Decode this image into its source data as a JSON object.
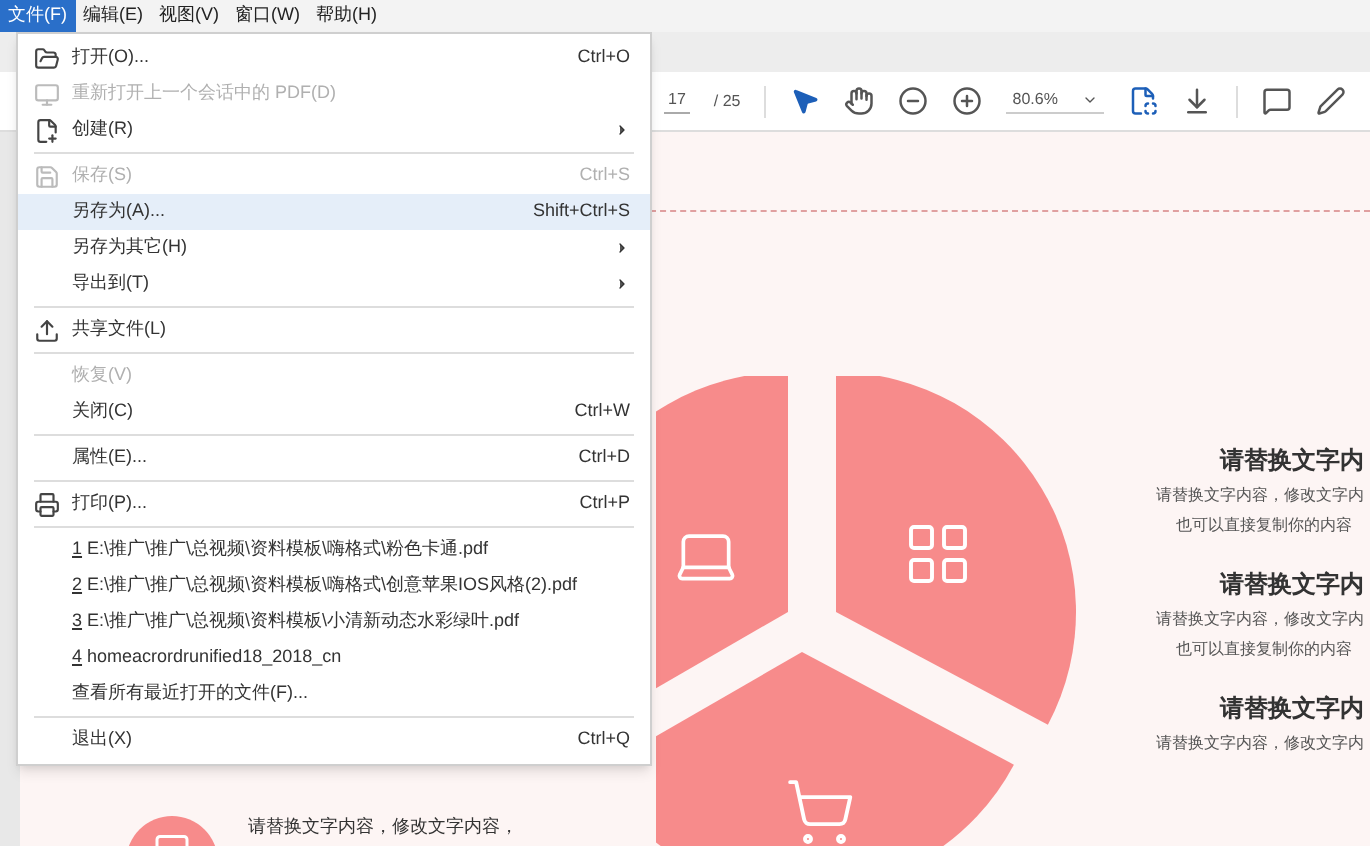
{
  "menubar": [
    {
      "label": "文件(F)",
      "selected": true
    },
    {
      "label": "编辑(E)",
      "selected": false
    },
    {
      "label": "视图(V)",
      "selected": false
    },
    {
      "label": "窗口(W)",
      "selected": false
    },
    {
      "label": "帮助(H)",
      "selected": false
    }
  ],
  "toolbar": {
    "page": "17",
    "page_total": "/ 25",
    "zoom": "80.6%",
    "tools": [
      {
        "kind": "pointer",
        "selected": true
      },
      {
        "kind": "hand",
        "selected": false
      }
    ]
  },
  "file_menu": [
    {
      "kind": "item",
      "label": "打开(O)...",
      "shortcut": "Ctrl+O",
      "disabled": false,
      "submenu": false,
      "selected": false
    },
    {
      "kind": "item",
      "label": "重新打开上一个会话中的 PDF(D)",
      "disabled": true,
      "submenu": false,
      "selected": false
    },
    {
      "kind": "item",
      "label": "创建(R)",
      "disabled": false,
      "submenu": true,
      "selected": false
    },
    {
      "kind": "separator"
    },
    {
      "kind": "item",
      "label": "保存(S)",
      "shortcut": "Ctrl+S",
      "disabled": true,
      "submenu": false,
      "selected": false
    },
    {
      "kind": "item",
      "label": "另存为(A)...",
      "shortcut": "Shift+Ctrl+S",
      "disabled": false,
      "submenu": false,
      "selected": true
    },
    {
      "kind": "item",
      "label": "另存为其它(H)",
      "disabled": false,
      "submenu": true,
      "selected": false
    },
    {
      "kind": "item",
      "label": "导出到(T)",
      "disabled": false,
      "submenu": true,
      "selected": false
    },
    {
      "kind": "separator"
    },
    {
      "kind": "item",
      "label": "共享文件(L)",
      "disabled": false,
      "submenu": false,
      "selected": false
    },
    {
      "kind": "separator"
    },
    {
      "kind": "item",
      "label": "恢复(V)",
      "disabled": true,
      "submenu": false,
      "selected": false
    },
    {
      "kind": "item",
      "label": "关闭(C)",
      "shortcut": "Ctrl+W",
      "disabled": false,
      "submenu": false,
      "selected": false
    },
    {
      "kind": "separator"
    },
    {
      "kind": "item",
      "label": "属性(E)...",
      "shortcut": "Ctrl+D",
      "disabled": false,
      "submenu": false,
      "selected": false
    },
    {
      "kind": "separator"
    },
    {
      "kind": "item",
      "label": "打印(P)...",
      "shortcut": "Ctrl+P",
      "disabled": false,
      "submenu": false,
      "selected": false
    },
    {
      "kind": "separator"
    },
    {
      "kind": "recent",
      "number": "1",
      "label": "E:\\推广\\推广\\总视频\\资料模板\\嗨格式\\粉色卡通.pdf"
    },
    {
      "kind": "recent",
      "number": "2",
      "label": "E:\\推广\\推广\\总视频\\资料模板\\嗨格式\\创意苹果IOS风格(2).pdf"
    },
    {
      "kind": "recent",
      "number": "3",
      "label": "E:\\推广\\推广\\总视频\\资料模板\\小清新动态水彩绿叶.pdf"
    },
    {
      "kind": "recent",
      "number": "4",
      "label": "homeacrordrunified18_2018_cn"
    },
    {
      "kind": "item",
      "label": "查看所有最近打开的文件(F)...",
      "disabled": false,
      "submenu": false,
      "selected": false
    },
    {
      "kind": "separator"
    },
    {
      "kind": "item",
      "label": "退出(X)",
      "shortcut": "Ctrl+Q",
      "disabled": false,
      "submenu": false,
      "selected": false
    }
  ],
  "slide": {
    "text_blocks": [
      {
        "heading": "请替换文字内",
        "lines": [
          "请替换文字内容，修改文字内",
          "也可以直接复制你的内容"
        ]
      },
      {
        "heading": "请替换文字内",
        "lines": [
          "请替换文字内容，修改文字内",
          "也可以直接复制你的内容"
        ]
      },
      {
        "heading": "请替换文字内",
        "lines": [
          "请替换文字内容，修改文字内"
        ]
      }
    ],
    "left_text": "请替换文字内容，修改文字内容，"
  }
}
